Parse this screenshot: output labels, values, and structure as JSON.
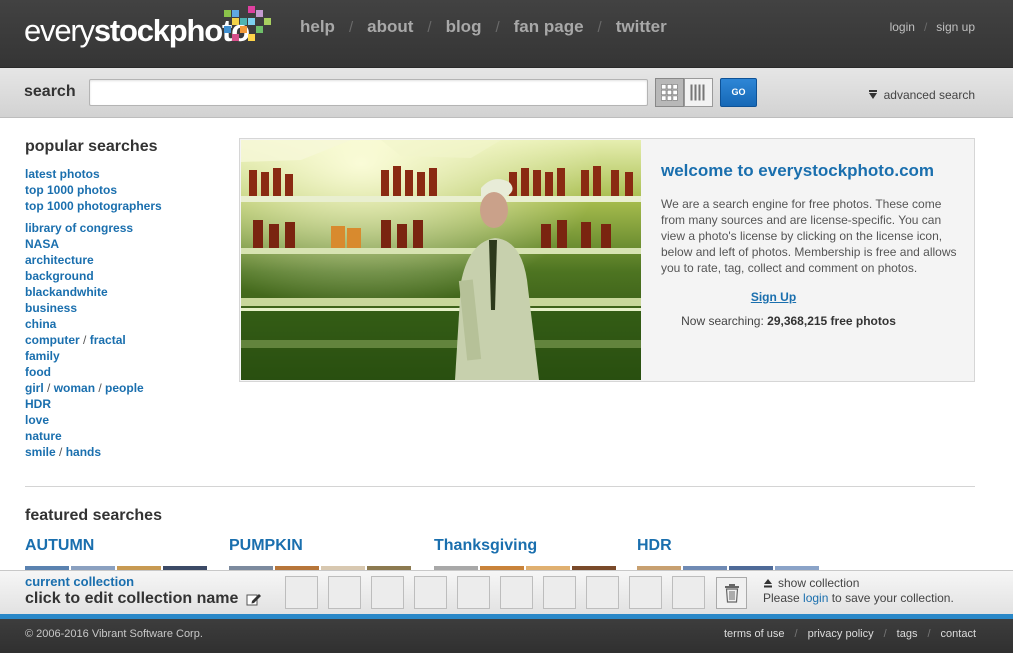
{
  "logo": {
    "text_light": "every",
    "text_bold": "stockphoto"
  },
  "nav": {
    "items": [
      "help",
      "about",
      "blog",
      "fan page",
      "twitter"
    ],
    "separator": "/"
  },
  "user_nav": {
    "login": "login",
    "signup": "sign up",
    "separator": "/"
  },
  "search": {
    "label": "search",
    "value": "",
    "placeholder": "",
    "go_label": "GO",
    "advanced_label": "advanced search"
  },
  "popular": {
    "title": "popular searches",
    "group1": [
      "latest photos",
      "top 1000 photos",
      "top 1000 photographers"
    ],
    "library": "library of congress",
    "nasa": "NASA",
    "architecture": "architecture",
    "background": "background",
    "blackandwhite": "blackandwhite",
    "business": "business",
    "china": "china",
    "computer": "computer",
    "fractal": "fractal",
    "family": "family",
    "food": "food",
    "girl": "girl",
    "woman": "woman",
    "people": "people",
    "hdr": "HDR",
    "love": "love",
    "nature": "nature",
    "smile": "smile",
    "hands": "hands",
    "slash": " / "
  },
  "welcome": {
    "title": "welcome to everystockphoto.com",
    "body": "We are a search engine for free photos. These come from many sources and are license-specific. You can view a photo's license by clicking on the license icon, below and left of photos. Membership is free and allows you to rate, tag, collect and comment on photos.",
    "signup": "Sign Up",
    "now_searching_prefix": "Now searching: ",
    "photo_count": "29,368,215 free photos"
  },
  "featured": {
    "title": "featured searches",
    "items": [
      "AUTUMN",
      "PUMPKIN",
      "Thanksgiving",
      "HDR"
    ]
  },
  "collection": {
    "label": "current collection",
    "name": "click to edit collection name",
    "show_label": "show collection",
    "save_prefix": "Please ",
    "save_link": "login",
    "save_suffix": " to save your collection."
  },
  "footer": {
    "copyright": "© 2006-2016 Vibrant Software Corp.",
    "links": [
      "terms of use",
      "privacy policy",
      "tags",
      "contact"
    ],
    "separator": "/"
  },
  "colors": {
    "link_blue": "#1a6fae",
    "go_button": "#1e73c8",
    "collection_accent": "#2a88c8"
  }
}
